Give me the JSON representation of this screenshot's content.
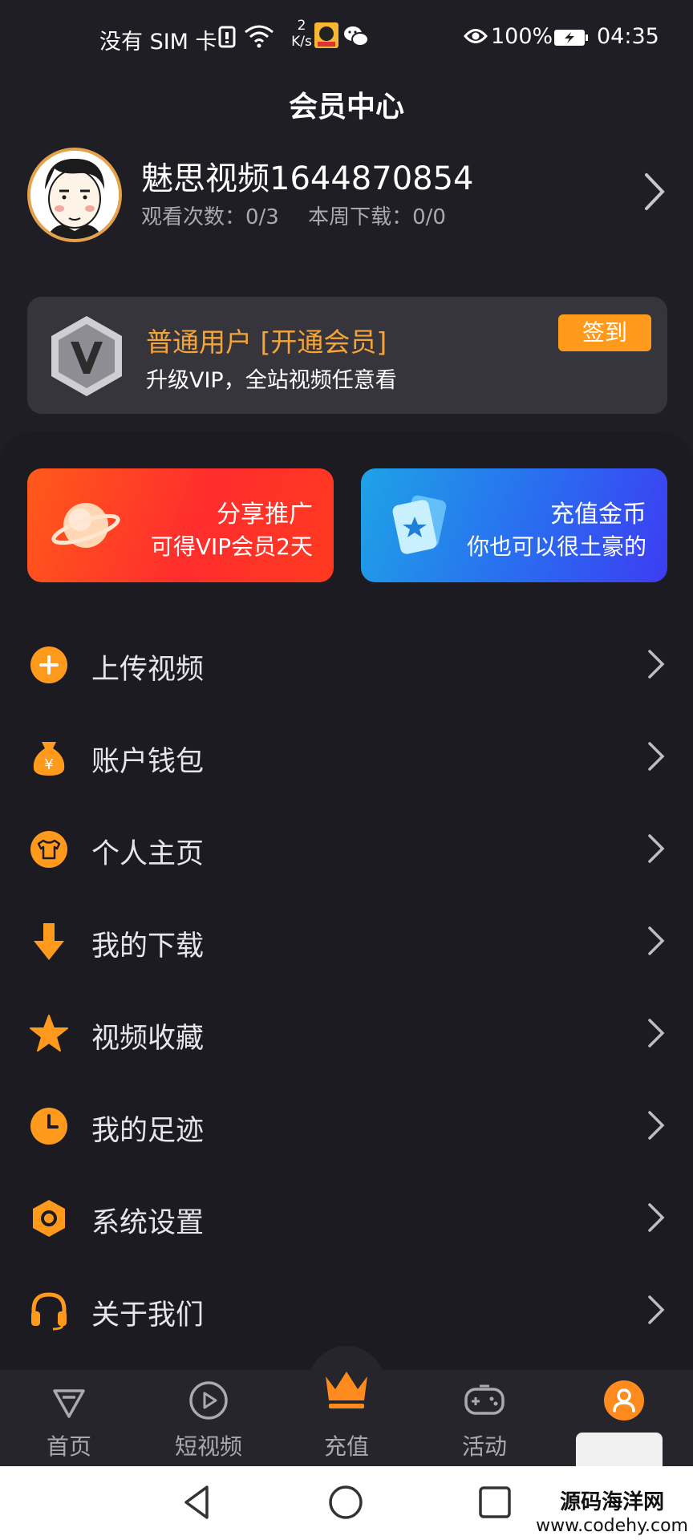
{
  "status_bar": {
    "carrier": "没有 SIM 卡",
    "net_speed_value": "2",
    "net_speed_unit": "K/s",
    "battery": "100%",
    "time": "04:35"
  },
  "page": {
    "title": "会员中心"
  },
  "profile": {
    "username": "魅思视频1644870854",
    "views": "观看次数：0/3",
    "downloads": "本周下载：0/0"
  },
  "member_card": {
    "title": "普通用户 [开通会员]",
    "subtitle": "升级VIP，全站视频任意看",
    "checkin_label": "签到"
  },
  "promos": [
    {
      "title": "分享推广",
      "subtitle": "可得VIP会员2天"
    },
    {
      "title": "充值金币",
      "subtitle": "你也可以很土豪的"
    }
  ],
  "menu": [
    {
      "label": "上传视频",
      "icon": "plus-circle-icon"
    },
    {
      "label": "账户钱包",
      "icon": "money-bag-icon"
    },
    {
      "label": "个人主页",
      "icon": "shirt-icon"
    },
    {
      "label": "我的下载",
      "icon": "download-arrow-icon"
    },
    {
      "label": "视频收藏",
      "icon": "star-icon"
    },
    {
      "label": "我的足迹",
      "icon": "clock-icon"
    },
    {
      "label": "系统设置",
      "icon": "hexagon-settings-icon"
    },
    {
      "label": "关于我们",
      "icon": "headset-icon"
    }
  ],
  "bottom_nav": [
    {
      "label": "首页",
      "icon": "diamond-icon"
    },
    {
      "label": "短视频",
      "icon": "play-circle-icon"
    },
    {
      "label": "充值",
      "icon": "crown-icon"
    },
    {
      "label": "活动",
      "icon": "gamepad-icon"
    },
    {
      "label": "",
      "icon": "user-icon"
    }
  ],
  "watermark": {
    "line1": "源码海洋网",
    "line2": "www.codehy.com"
  },
  "colors": {
    "accent": "#ff9a1d",
    "background": "#1e1e24",
    "member_gold": "#f5a43a"
  }
}
